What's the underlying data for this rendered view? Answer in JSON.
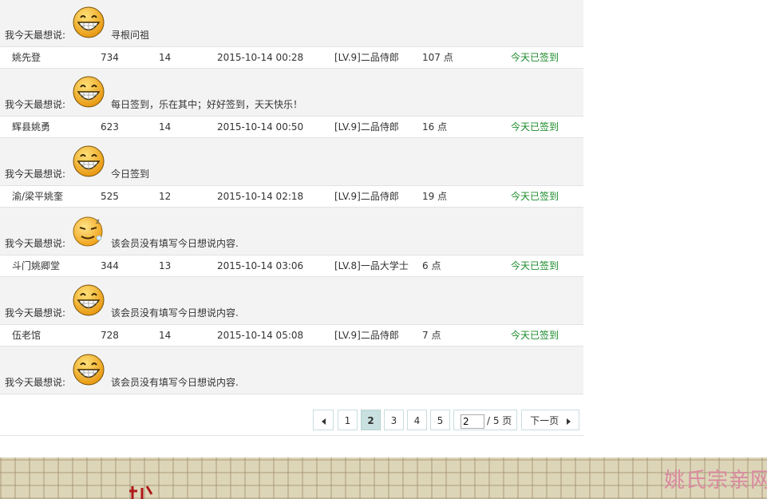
{
  "mood_label": "我今天最想说:",
  "entries": [
    {
      "message": "寻根问祖",
      "face": "grin",
      "user": {
        "name": "姚先登",
        "col1": "734",
        "col2": "14",
        "time": "2015-10-14 00:28",
        "level": "[LV.9]二品侍郎",
        "points": "107 点",
        "status": "今天已签到"
      }
    },
    {
      "message": "每日签到，乐在其中；好好签到，天天快乐！",
      "face": "grin",
      "user": {
        "name": "辉县姚勇",
        "col1": "623",
        "col2": "14",
        "time": "2015-10-14 00:50",
        "level": "[LV.9]二品侍郎",
        "points": "16 点",
        "status": "今天已签到"
      }
    },
    {
      "message": "今日签到",
      "face": "grin",
      "user": {
        "name": "渝/梁平姚奎",
        "col1": "525",
        "col2": "12",
        "time": "2015-10-14 02:18",
        "level": "[LV.9]二品侍郎",
        "points": "19 点",
        "status": "今天已签到"
      }
    },
    {
      "message": "该会员没有填写今日想说内容.",
      "face": "sleepy",
      "user": {
        "name": "斗门姚卿堂",
        "col1": "344",
        "col2": "13",
        "time": "2015-10-14 03:06",
        "level": "[LV.8]一品大学士",
        "points": "6 点",
        "status": "今天已签到"
      }
    },
    {
      "message": "该会员没有填写今日想说内容.",
      "face": "grin",
      "user": {
        "name": "伍老馆",
        "col1": "728",
        "col2": "14",
        "time": "2015-10-14 05:08",
        "level": "[LV.9]二品侍郎",
        "points": "7 点",
        "status": "今天已签到"
      }
    },
    {
      "message": "该会员没有填写今日想说内容.",
      "face": "grin",
      "user": null
    }
  ],
  "pagination": {
    "pages": [
      "1",
      "2",
      "3",
      "4",
      "5"
    ],
    "current": "2",
    "input_value": "2",
    "total_text": "/ 5 页",
    "next_label": "下一页"
  },
  "footer": {
    "site_name": "姚氏宗亲网",
    "colors": {
      "background": "#ddd5b8",
      "site_text": "#d98aa0",
      "mark": "#b01818"
    }
  },
  "colors": {
    "status_green": "#1b8b2a",
    "row_bg": "#f3f3f3",
    "current_page_bg": "#c9e0e0"
  }
}
